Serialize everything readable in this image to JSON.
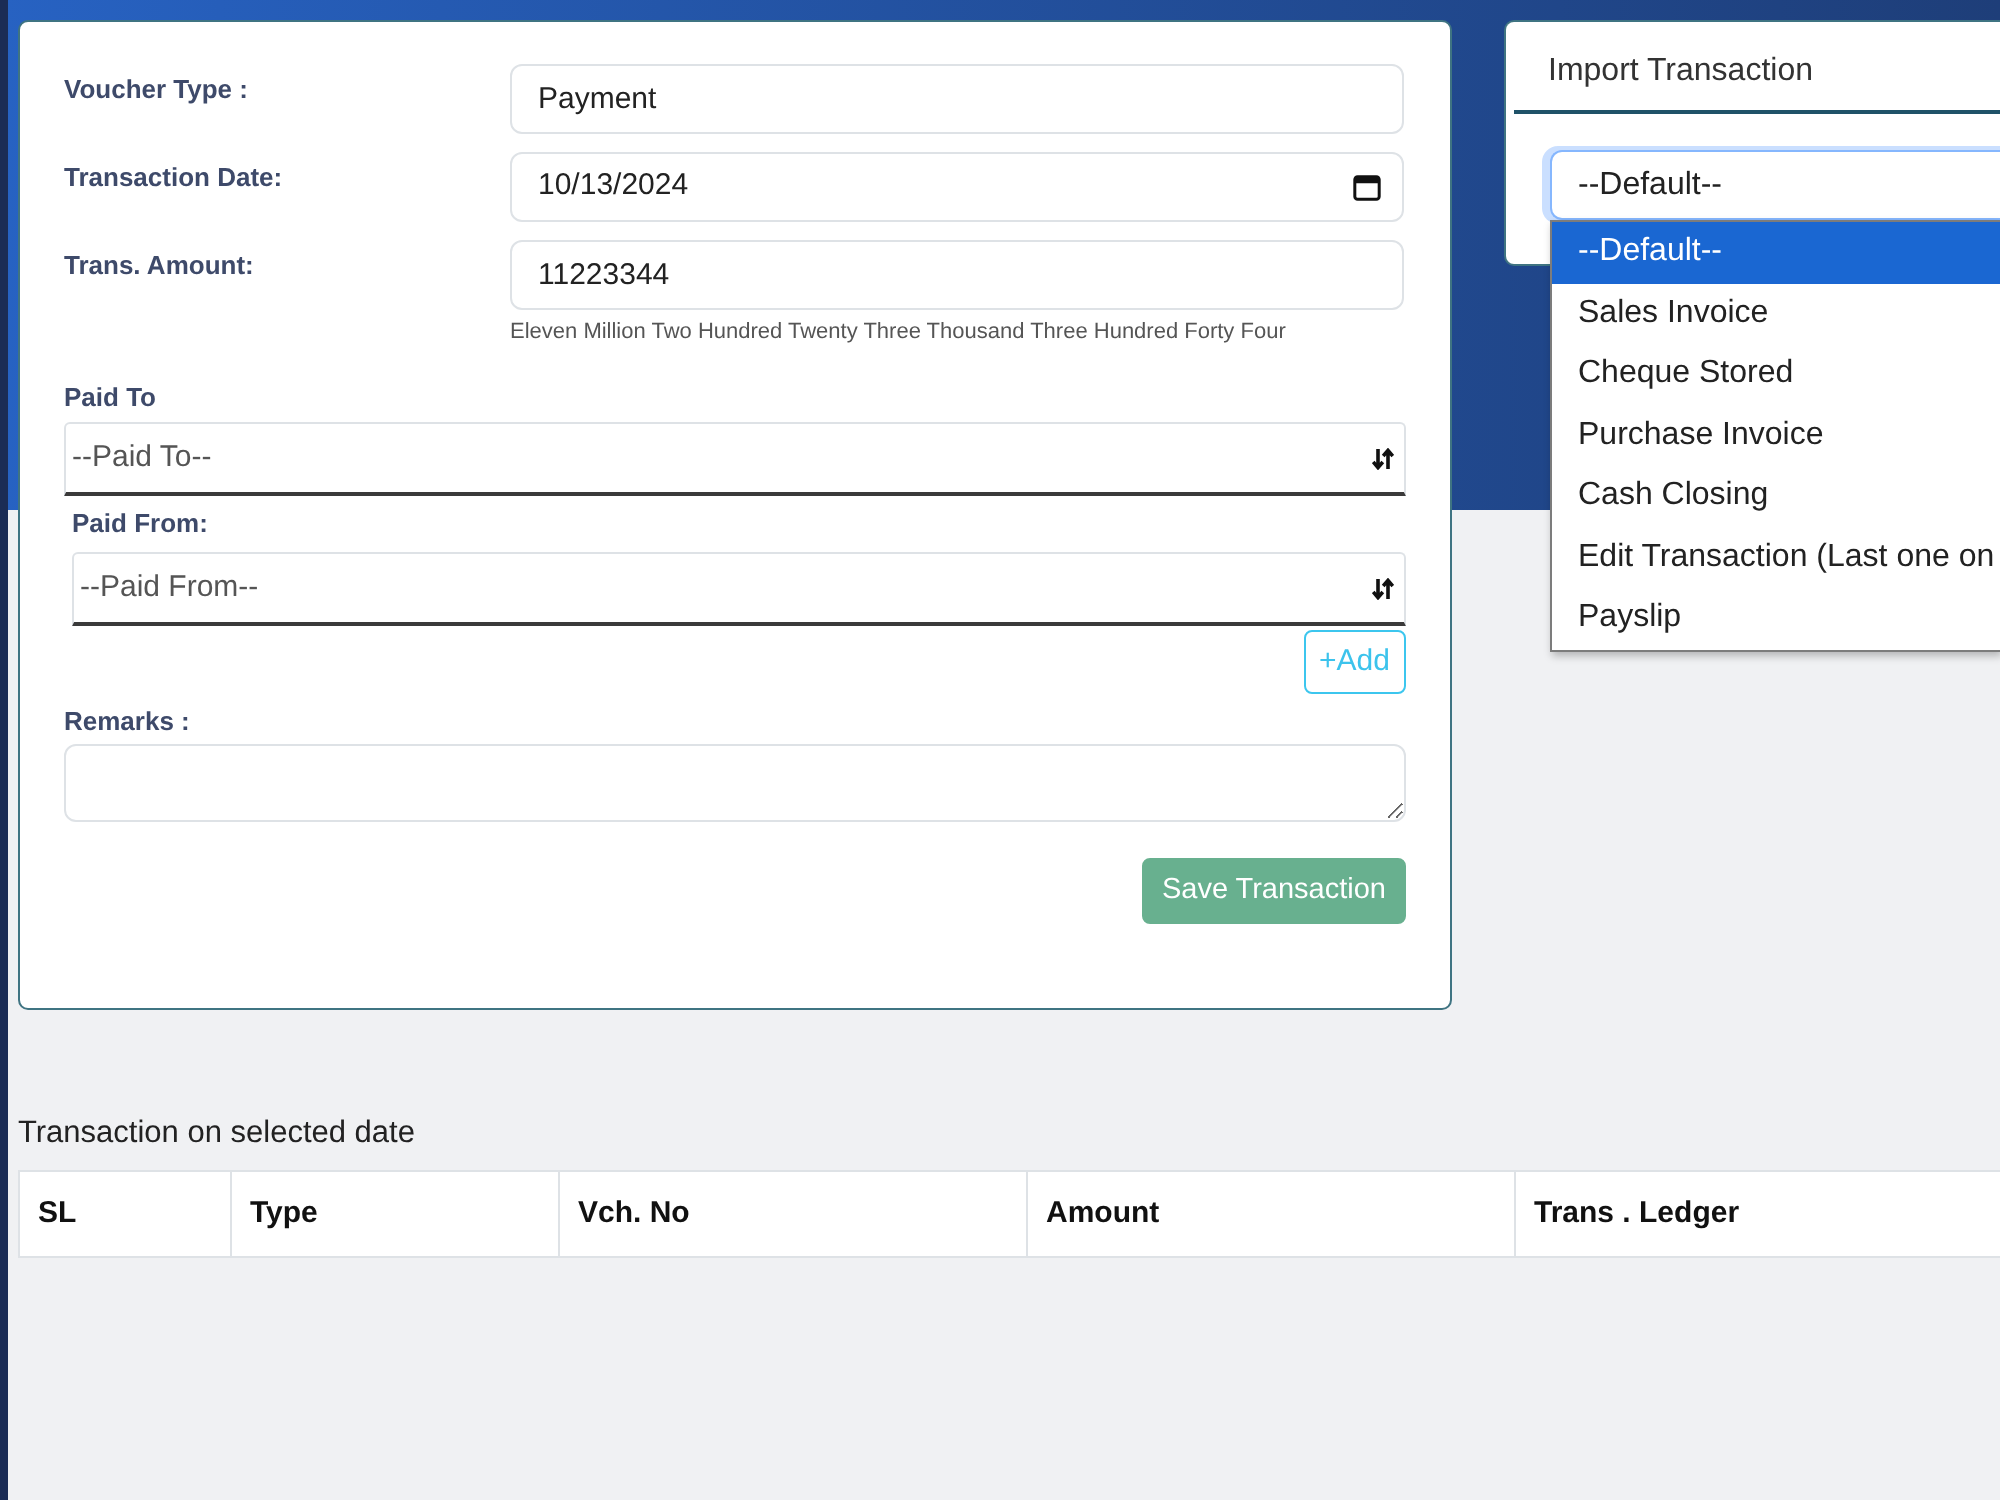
{
  "form": {
    "fields": [
      {
        "kind": "text",
        "label": "Voucher Type :",
        "value": "Payment"
      },
      {
        "kind": "date",
        "label": "Transaction Date:",
        "value": "10/13/2024"
      },
      {
        "kind": "text",
        "label": "Trans. Amount:",
        "value": "11223344",
        "hint": "Eleven Million Two Hundred Twenty Three Thousand Three Hundred Forty Four"
      }
    ],
    "selects": [
      {
        "label": "Paid To",
        "placeholder": "--Paid To--"
      },
      {
        "label": "Paid From:",
        "placeholder": "--Paid From--"
      }
    ],
    "add_button": "+Add",
    "remarks": {
      "label": "Remarks :"
    },
    "save_button": {
      "label": "Save Transaction",
      "disabled": true
    }
  },
  "import": {
    "title": "Import Transaction",
    "select": {
      "value": "--Default--",
      "expanded": true,
      "options": [
        {
          "label": "--Default--",
          "selected": true
        },
        {
          "label": "Sales Invoice",
          "selected": false
        },
        {
          "label": "Cheque Stored",
          "selected": false
        },
        {
          "label": "Purchase Invoice",
          "selected": false
        },
        {
          "label": "Cash Closing",
          "selected": false
        },
        {
          "label": "Edit Transaction (Last one on",
          "selected": false
        },
        {
          "label": "Payslip",
          "selected": false
        }
      ]
    }
  },
  "table": {
    "title": "Transaction on selected date",
    "columns": [
      "SL",
      "Type",
      "Vch. No",
      "Amount",
      "Trans . Ledger"
    ]
  }
}
